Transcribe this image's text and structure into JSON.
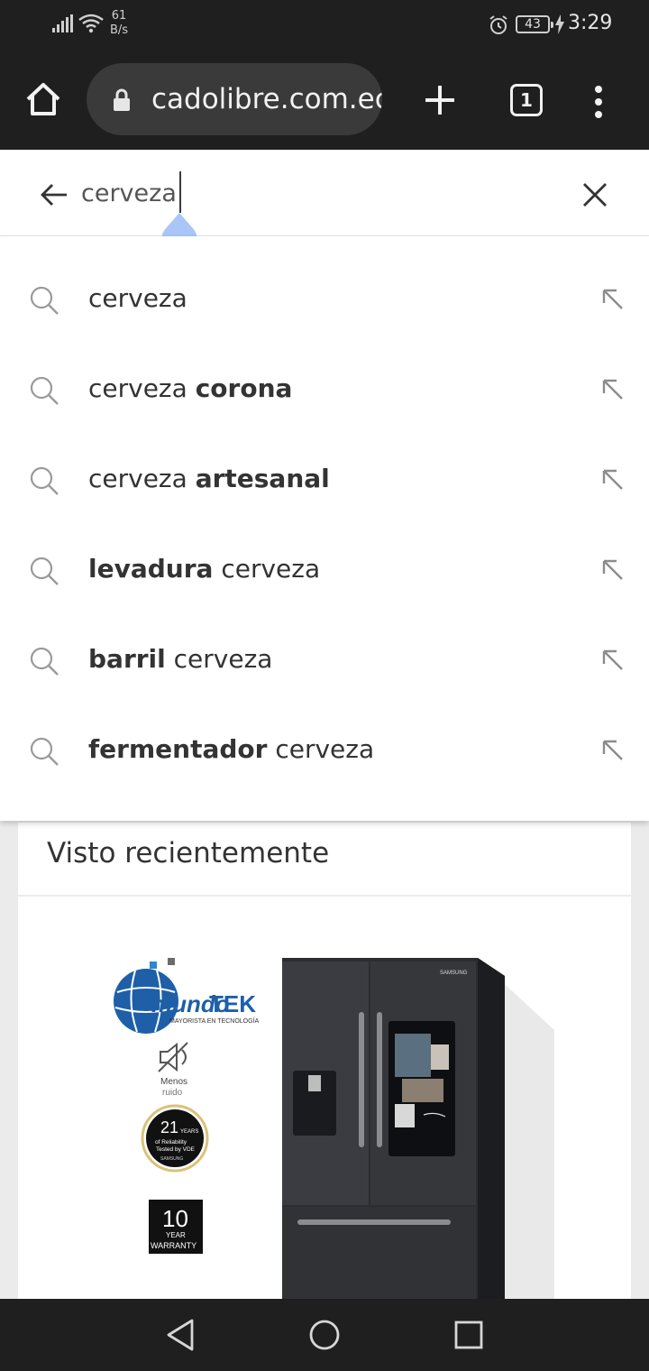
{
  "status_bar": {
    "net_speed_value": "61",
    "net_speed_unit": "B/s",
    "battery": "43",
    "time": "3:29",
    "icons": [
      "signal-icon",
      "wifi-icon",
      "alarm-icon",
      "battery-icon",
      "charging-icon"
    ]
  },
  "browser": {
    "url": "cadolibre.com.ec",
    "tab_count": "1",
    "icons": [
      "home-icon",
      "lock-icon",
      "plus-icon",
      "tabs-icon",
      "more-vert-icon"
    ]
  },
  "search": {
    "query": "cerveza",
    "icons": [
      "arrow-back-icon",
      "close-icon",
      "text-cursor-handle-icon"
    ]
  },
  "suggestions": [
    {
      "parts": [
        {
          "t": "cerveza",
          "b": false
        }
      ]
    },
    {
      "parts": [
        {
          "t": "cerveza ",
          "b": false
        },
        {
          "t": "corona",
          "b": true
        }
      ]
    },
    {
      "parts": [
        {
          "t": "cerveza ",
          "b": false
        },
        {
          "t": "artesanal",
          "b": true
        }
      ]
    },
    {
      "parts": [
        {
          "t": "levadura",
          "b": true
        },
        {
          "t": " cerveza",
          "b": false
        }
      ]
    },
    {
      "parts": [
        {
          "t": "barril",
          "b": true
        },
        {
          "t": " cerveza",
          "b": false
        }
      ]
    },
    {
      "parts": [
        {
          "t": "fermentador",
          "b": true
        },
        {
          "t": " cerveza",
          "b": false
        }
      ]
    }
  ],
  "suggestion_icons": [
    "search-icon",
    "fill-query-arrow-icon"
  ],
  "recent": {
    "title": "Visto recientemente",
    "product_logo_word1": "mundo",
    "product_logo_word2": "TEK",
    "product_logo_tagline": "MAYORISTA EN TECNOLOGÍA",
    "feature_noise_line1": "Menos",
    "feature_noise_line2": "ruido",
    "badge_years_number": "21",
    "badge_years_word": "YEARS",
    "badge_line1": "of Reliability",
    "badge_line2": "Tested by VDE",
    "badge_brand": "SAMSUNG",
    "warranty_number": "10",
    "warranty_line1": "YEAR",
    "warranty_line2": "WARRANTY",
    "fridge_brand": "SAMSUNG"
  },
  "nav": {
    "icons": [
      "nav-back-icon",
      "nav-home-icon",
      "nav-recents-icon"
    ]
  }
}
